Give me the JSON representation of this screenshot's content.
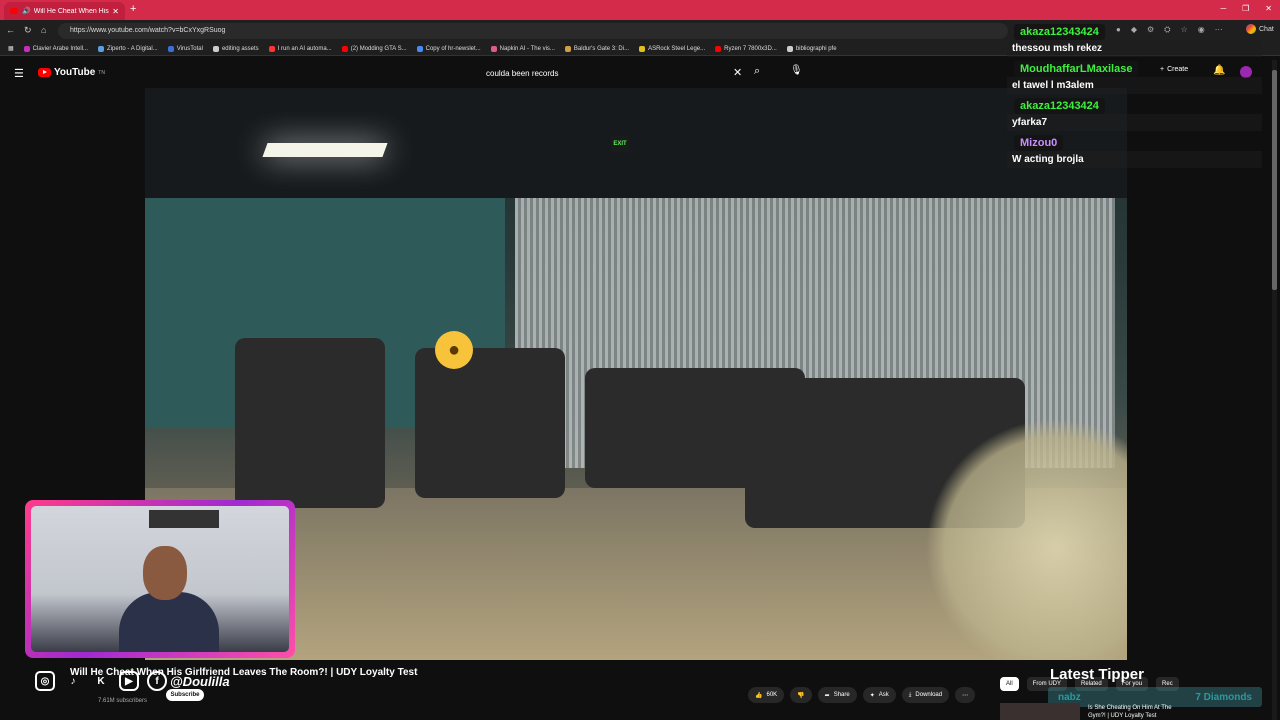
{
  "browser": {
    "tab_title": "Will He Cheat When His Girlfri",
    "url": "https://www.youtube.com/watch?v=bCxYxgRSuog",
    "chat_button": "Chat",
    "bookmarks": [
      {
        "label": "Clavier Arabe Intell...",
        "color": "#c62dc1"
      },
      {
        "label": "Ziperto - A Digital...",
        "color": "#5aa0e0"
      },
      {
        "label": "VirusTotal",
        "color": "#3b6fd8"
      },
      {
        "label": "editing assets",
        "color": "#cccccc"
      },
      {
        "label": "I run an AI automa...",
        "color": "#ff3333"
      },
      {
        "label": "(2) Modding GTA S...",
        "color": "#ff0000"
      },
      {
        "label": "Copy of hr-newslet...",
        "color": "#4a8af4"
      },
      {
        "label": "Napkin AI - The vis...",
        "color": "#e05a90"
      },
      {
        "label": "Baldur's Gate 3: Di...",
        "color": "#d0a040"
      },
      {
        "label": "ASRock Steel Lege...",
        "color": "#e0c020"
      },
      {
        "label": "Ryzen 7 7800x3D...",
        "color": "#ff0000"
      },
      {
        "label": "bibliographi pfe",
        "color": "#cccccc"
      }
    ]
  },
  "youtube": {
    "logo_text": "YouTube",
    "logo_sup": "TN",
    "search_value": "coulda been records",
    "create_label": "Create"
  },
  "chat": [
    {
      "name": "akaza12343424",
      "name_color": "#3ef03e",
      "text": "thessou msh rekez"
    },
    {
      "name": "MoudhaffarLMaxilase",
      "name_color": "#3ef03e",
      "text": "el tawel l m3alem"
    },
    {
      "name": "akaza12343424",
      "name_color": "#3ef03e",
      "text": "yfarka7"
    },
    {
      "name": "Mizou0",
      "name_color": "#c890ff",
      "text": "W acting brojla"
    }
  ],
  "video": {
    "title": "Will He Cheat When His Girlfriend Leaves The Room?! | UDY Loyalty Test",
    "exit_sign": "EXIT",
    "handle": "@Doulilla",
    "subscribers": "7.61M subscribers",
    "subscribe_label": "Subscribe",
    "likes": "60K",
    "share_label": "Share",
    "ask_label": "Ask",
    "download_label": "Download"
  },
  "sidebar": {
    "latest_tipper": "Latest Tipper",
    "chips": [
      "All",
      "From UDY",
      "Related",
      "For you",
      "Rec"
    ],
    "tipper_name": "nabz",
    "tipper_amount": "7 Diamonds",
    "rec_title": "Is She Cheating On Him At The Gym?! | UDY Loyalty Test"
  }
}
